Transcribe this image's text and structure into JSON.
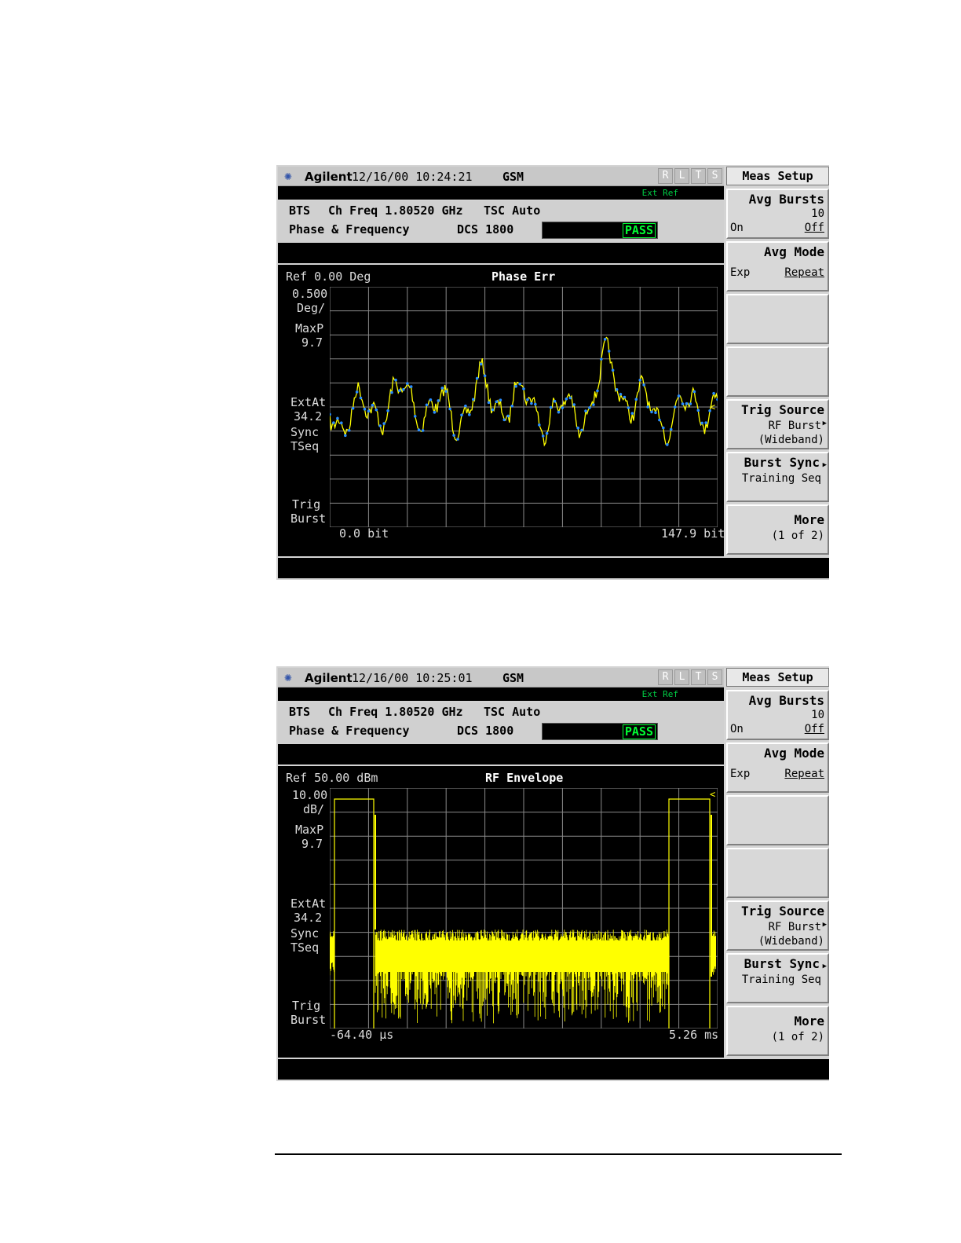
{
  "screens": [
    {
      "titlebar": {
        "brand": "Agilent",
        "datetime": "12/16/00 10:24:21",
        "mode": "GSM",
        "indicators": [
          "R",
          "L",
          "T",
          "S"
        ]
      },
      "ext_ref": "Ext Ref",
      "info": {
        "device": "BTS",
        "ch_freq": "Ch Freq 1.80520 GHz",
        "tsc": "TSC Auto",
        "measurement": "Phase & Frequency",
        "band": "DCS 1800",
        "status": "PASS"
      },
      "plot": {
        "ref": "Ref 0.00 Deg",
        "title": "Phase Err",
        "scale": "0.500",
        "scale_unit": "Deg/",
        "maxp": "MaxP",
        "maxp_val": "9.7",
        "extat": "ExtAt",
        "extat_val": "34.2",
        "sync": "Sync",
        "tseq": "TSeq",
        "trig": "Trig",
        "burst": "Burst",
        "x_start": "0.0 bit",
        "x_end": "147.9 bit"
      },
      "softkeys": {
        "header": "Meas Setup",
        "avg_bursts": {
          "title": "Avg Bursts",
          "value": "10",
          "on": "On",
          "off": "Off"
        },
        "avg_mode": {
          "title": "Avg Mode",
          "left": "Exp",
          "right": "Repeat"
        },
        "trig_source": {
          "title": "Trig Source",
          "line1": "RF Burst",
          "line2": "(Wideband)"
        },
        "burst_sync": {
          "title": "Burst Sync",
          "line1": "Training Seq"
        },
        "more": {
          "title": "More",
          "line1": "(1 of 2)"
        }
      }
    },
    {
      "titlebar": {
        "brand": "Agilent",
        "datetime": "12/16/00 10:25:01",
        "mode": "GSM",
        "indicators": [
          "R",
          "L",
          "T",
          "S"
        ]
      },
      "ext_ref": "Ext Ref",
      "info": {
        "device": "BTS",
        "ch_freq": "Ch Freq 1.80520 GHz",
        "tsc": "TSC Auto",
        "measurement": "Phase & Frequency",
        "band": "DCS 1800",
        "status": "PASS"
      },
      "plot": {
        "ref": "Ref 50.00 dBm",
        "title": "RF Envelope",
        "scale": "10.00",
        "scale_unit": "dB/",
        "maxp": "MaxP",
        "maxp_val": "9.7",
        "extat": "ExtAt",
        "extat_val": "34.2",
        "sync": "Sync",
        "tseq": "TSeq",
        "trig": "Trig",
        "burst": "Burst",
        "x_start": "-64.40 μs",
        "x_end": "5.26 ms"
      },
      "softkeys": {
        "header": "Meas Setup",
        "avg_bursts": {
          "title": "Avg Bursts",
          "value": "10",
          "on": "On",
          "off": "Off"
        },
        "avg_mode": {
          "title": "Avg Mode",
          "left": "Exp",
          "right": "Repeat"
        },
        "trig_source": {
          "title": "Trig Source",
          "line1": "RF Burst",
          "line2": "(Wideband)"
        },
        "burst_sync": {
          "title": "Burst Sync",
          "line1": "Training Seq"
        },
        "more": {
          "title": "More",
          "line1": "(1 of 2)"
        }
      }
    }
  ],
  "colors": {
    "trace": "#ffff00",
    "marker": "#2a8cff",
    "grid": "#8a8a8a",
    "pass": "#00ff33",
    "ext_ref": "#00cc44"
  }
}
